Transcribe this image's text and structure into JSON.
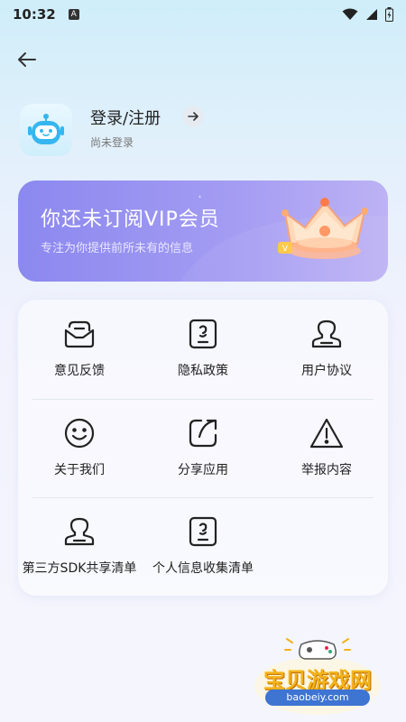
{
  "status_bar": {
    "time": "10:32",
    "notification_badge": "A"
  },
  "profile": {
    "login_label": "登录/注册",
    "status": "尚未登录"
  },
  "vip": {
    "title": "你还未订阅VIP会员",
    "subtitle": "专注为你提供前所未有的信息"
  },
  "menu": {
    "items": [
      {
        "label": "意见反馈",
        "icon": "feedback-icon"
      },
      {
        "label": "隐私政策",
        "icon": "privacy-icon"
      },
      {
        "label": "用户协议",
        "icon": "user-agreement-icon"
      },
      {
        "label": "关于我们",
        "icon": "smile-icon"
      },
      {
        "label": "分享应用",
        "icon": "share-icon"
      },
      {
        "label": "举报内容",
        "icon": "warning-icon"
      },
      {
        "label": "第三方SDK共享清单",
        "icon": "user-agreement-icon"
      },
      {
        "label": "个人信息收集清单",
        "icon": "privacy-icon"
      }
    ]
  },
  "watermark": {
    "text": "宝贝游戏网",
    "url": "baobeiy.com"
  },
  "colors": {
    "accent": "#8b88ef",
    "text": "#222222",
    "watermark": "#f3b21b"
  }
}
